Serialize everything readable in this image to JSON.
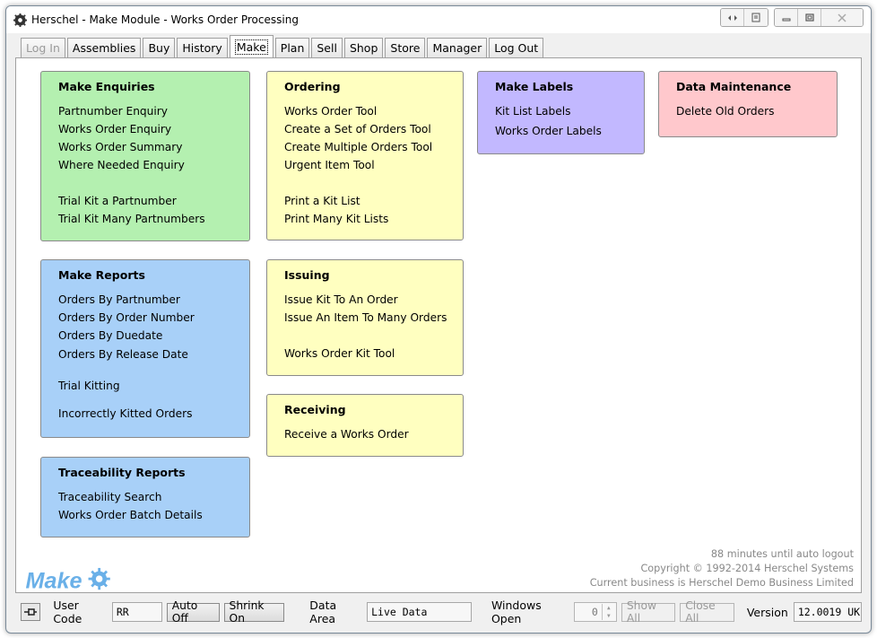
{
  "window": {
    "title": "Herschel - Make Module - Works Order Processing"
  },
  "tabs": [
    {
      "label": "Log In",
      "state": "disabled"
    },
    {
      "label": "Assemblies",
      "state": "normal"
    },
    {
      "label": "Buy",
      "state": "normal"
    },
    {
      "label": "History",
      "state": "normal"
    },
    {
      "label": "Make",
      "state": "active"
    },
    {
      "label": "Plan",
      "state": "normal"
    },
    {
      "label": "Sell",
      "state": "normal"
    },
    {
      "label": "Shop",
      "state": "normal"
    },
    {
      "label": "Store",
      "state": "normal"
    },
    {
      "label": "Manager",
      "state": "normal"
    },
    {
      "label": "Log Out",
      "state": "normal"
    }
  ],
  "sections": {
    "make_enquiries": {
      "title": "Make Enquiries",
      "items": [
        "Partnumber Enquiry",
        "Works Order Enquiry",
        "Works Order Summary",
        "Where Needed Enquiry",
        "Trial Kit a Partnumber",
        "Trial Kit Many Partnumbers"
      ]
    },
    "ordering": {
      "title": "Ordering",
      "items": [
        "Works Order Tool",
        "Create a Set of Orders Tool",
        "Create Multiple Orders Tool",
        "Urgent Item Tool",
        "Print a Kit List",
        "Print Many Kit Lists"
      ]
    },
    "make_labels": {
      "title": "Make Labels",
      "items": [
        "Kit List Labels",
        "Works Order Labels"
      ]
    },
    "data_maintenance": {
      "title": "Data Maintenance",
      "items": [
        "Delete Old Orders"
      ]
    },
    "make_reports": {
      "title": "Make Reports",
      "items": [
        "Orders By Partnumber",
        "Orders By Order Number",
        "Orders By Duedate",
        "Orders By Release Date",
        "Trial Kitting",
        "Incorrectly Kitted Orders"
      ]
    },
    "issuing": {
      "title": "Issuing",
      "items": [
        "Issue Kit To An Order",
        "Issue An Item To Many Orders",
        "Works Order Kit Tool"
      ]
    },
    "receiving": {
      "title": "Receiving",
      "items": [
        "Receive a Works Order"
      ]
    },
    "traceability": {
      "title": "Traceability Reports",
      "items": [
        "Traceability Search",
        "Works Order Batch Details"
      ]
    }
  },
  "colors": {
    "green": "#b4f0b0",
    "yellow": "#ffffc0",
    "purple": "#c2b8ff",
    "pink": "#ffc8cc",
    "blue": "#a8d0f8",
    "logo": "#6ab0e8"
  },
  "status": {
    "auto_logout": "88 minutes until auto logout",
    "copyright": "Copyright © 1992-2014 Herschel Systems",
    "business": "Current business is Herschel Demo Business Limited"
  },
  "logo_text": "Make",
  "bottombar": {
    "user_code_label": "User Code",
    "user_code_value": "RR",
    "auto_off_label": "Auto Off",
    "shrink_on_label": "Shrink On",
    "data_area_label": "Data Area",
    "data_area_value": "Live Data",
    "windows_open_label": "Windows Open",
    "windows_open_value": "0",
    "show_all_label": "Show All",
    "close_all_label": "Close All",
    "version_label": "Version",
    "version_value": "12.0019 UK"
  },
  "icons": {
    "app": "herschel-cog-icon",
    "pin": "pin-icon"
  }
}
